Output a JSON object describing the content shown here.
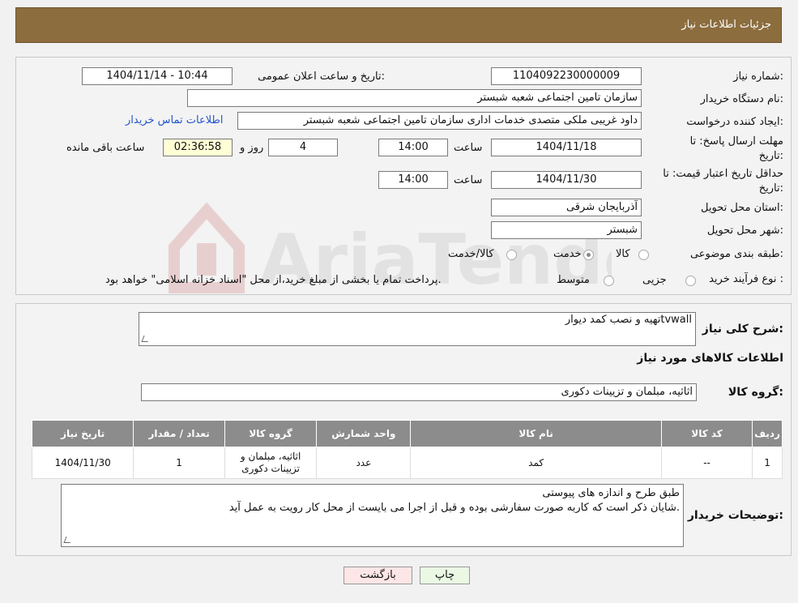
{
  "header": {
    "title": "جزئیات اطلاعات نیاز"
  },
  "form": {
    "need_number_label": "شماره نیاز:",
    "need_number": "1104092230000009",
    "announce_label": "تاریخ و ساعت اعلان عمومی:",
    "announce_value": "1404/11/14 - 10:44",
    "buyer_org_label": "نام دستگاه خریدار:",
    "buyer_org": "سازمان تامین اجتماعی شعبه شبستر",
    "creator_label": "ایجاد کننده درخواست:",
    "creator": "داود غریبی ملکی متصدی خدمات اداری سازمان تامین اجتماعی شعبه شبستر",
    "contact_link": "اطلاعات تماس خریدار",
    "deadline_label_1": "مهلت ارسال پاسخ: تا",
    "deadline_label_2": "تاریخ:",
    "deadline_date": "1404/11/18",
    "time_label": "ساعت",
    "deadline_time": "14:00",
    "days_value": "4",
    "days_label": "روز و",
    "remaining_time": "02:36:58",
    "remaining_label": "ساعت باقی مانده",
    "validity_label_1": "حداقل تاریخ اعتبار قیمت: تا",
    "validity_label_2": "تاریخ:",
    "validity_date": "1404/11/30",
    "validity_time": "14:00",
    "province_label": "استان محل تحویل:",
    "province": "آذربایجان شرقی",
    "city_label": "شهر محل تحویل:",
    "city": "شبستر",
    "category_label": "طبقه بندی موضوعی:",
    "category_options": [
      "کالا",
      "خدمت",
      "کالا/خدمت"
    ],
    "process_label": "نوع فرآیند خرید :",
    "process_options": [
      "جزیی",
      "متوسط"
    ],
    "process_note": "پرداخت تمام یا بخشی از مبلغ خرید،از محل \"اسناد خزانه اسلامی\" خواهد بود."
  },
  "summary": {
    "desc_label": "شرح کلی نیاز:",
    "desc_value": "تهیه و نصب کمد دیوارtvwall",
    "goods_info_title": "اطلاعات کالاهای مورد نیاز",
    "group_label": "گروه کالا:",
    "group_value": "اثاثیه، مبلمان و تزیینات دکوری"
  },
  "table": {
    "headers": [
      "ردیف",
      "کد کالا",
      "نام کالا",
      "واحد شمارش",
      "گروه کالا",
      "تعداد / مقدار",
      "تاریخ نیاز"
    ],
    "rows": [
      [
        "1",
        "--",
        "کمد",
        "عدد",
        "اثاثیه، مبلمان و تزیینات دکوری",
        "1",
        "1404/11/30"
      ]
    ]
  },
  "buyer_notes": {
    "label": "توضیحات خریدار:",
    "line1": "طبق طرح و اندازه های پیوستی",
    "line2": "شایان ذکر است که کاربه صورت سفارشی بوده و قبل از اجرا می بایست از محل کار رویت به عمل آید."
  },
  "buttons": {
    "print": "چاپ",
    "back": "بازگشت"
  },
  "colors": {
    "header_bg": "#8c6d3e",
    "table_header_bg": "#8c8c8c",
    "link": "#2255cc"
  }
}
